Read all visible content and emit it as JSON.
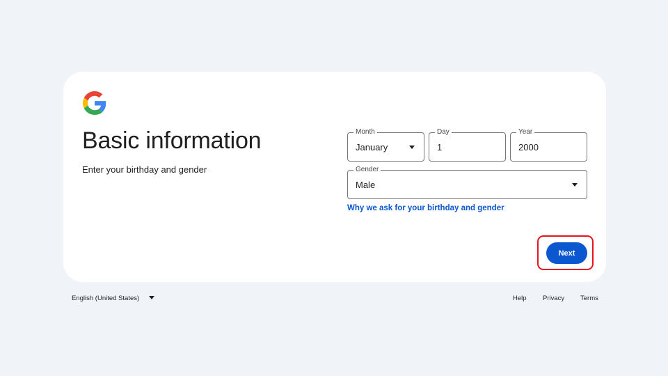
{
  "card": {
    "title": "Basic information",
    "subtitle": "Enter your birthday and gender"
  },
  "birthday": {
    "month_label": "Month",
    "month_value": "January",
    "day_label": "Day",
    "day_value": "1",
    "year_label": "Year",
    "year_value": "2000"
  },
  "gender": {
    "label": "Gender",
    "value": "Male"
  },
  "why_link": "Why we ask for your birthday and gender",
  "next_button": "Next",
  "footer": {
    "language": "English (United States)",
    "links": [
      "Help",
      "Privacy",
      "Terms"
    ]
  },
  "colors": {
    "background": "#f0f4f9",
    "primary": "#0b57d0",
    "highlight": "#e8131b"
  },
  "icons": {
    "logo": "google-logo",
    "dropdown": "chevron-down-icon"
  }
}
